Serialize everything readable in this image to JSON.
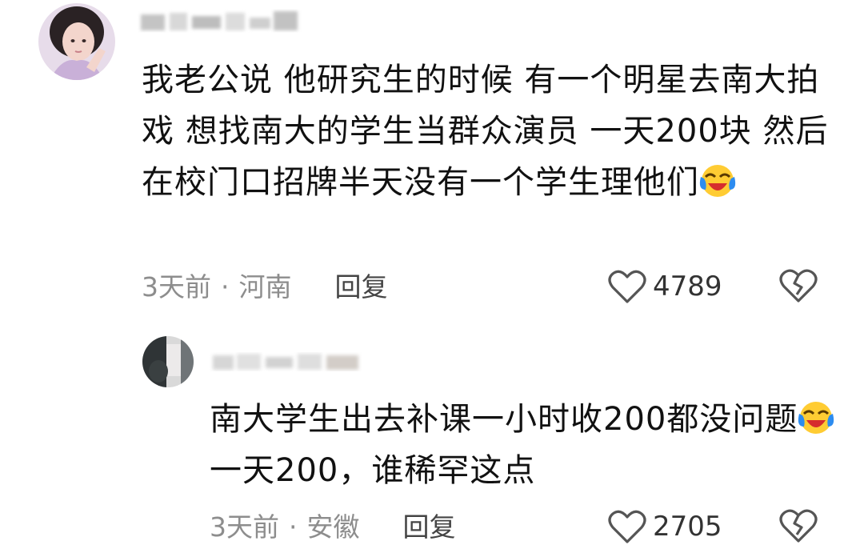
{
  "comments": [
    {
      "avatar_icon": "user-avatar",
      "username": "",
      "text": "我老公说 他研究生的时候 有一个明星去南大拍戏 想找南大的学生当群众演员 一天200块 然后在校门口招牌半天没有一个学生理他们",
      "emoji": "laughing-crying-emoji",
      "time": "3天前",
      "separator": "·",
      "location": "河南",
      "reply_label": "回复",
      "like_icon": "heart-outline-icon",
      "like_count": "4789",
      "dislike_icon": "broken-heart-icon"
    },
    {
      "avatar_icon": "user-avatar",
      "username": "",
      "text_part1": "南大学生出去补课一小时收200都没问题",
      "emoji": "laughing-crying-emoji",
      "text_part2": "一天200，谁稀罕这点",
      "time": "3天前",
      "separator": "·",
      "location": "安徽",
      "reply_label": "回复",
      "like_icon": "heart-outline-icon",
      "like_count": "2705",
      "dislike_icon": "broken-heart-icon"
    }
  ],
  "colors": {
    "text": "#111111",
    "meta": "#8d8d8d",
    "emoji_face": "#ffcc33",
    "emoji_tear": "#2d8cf0"
  }
}
